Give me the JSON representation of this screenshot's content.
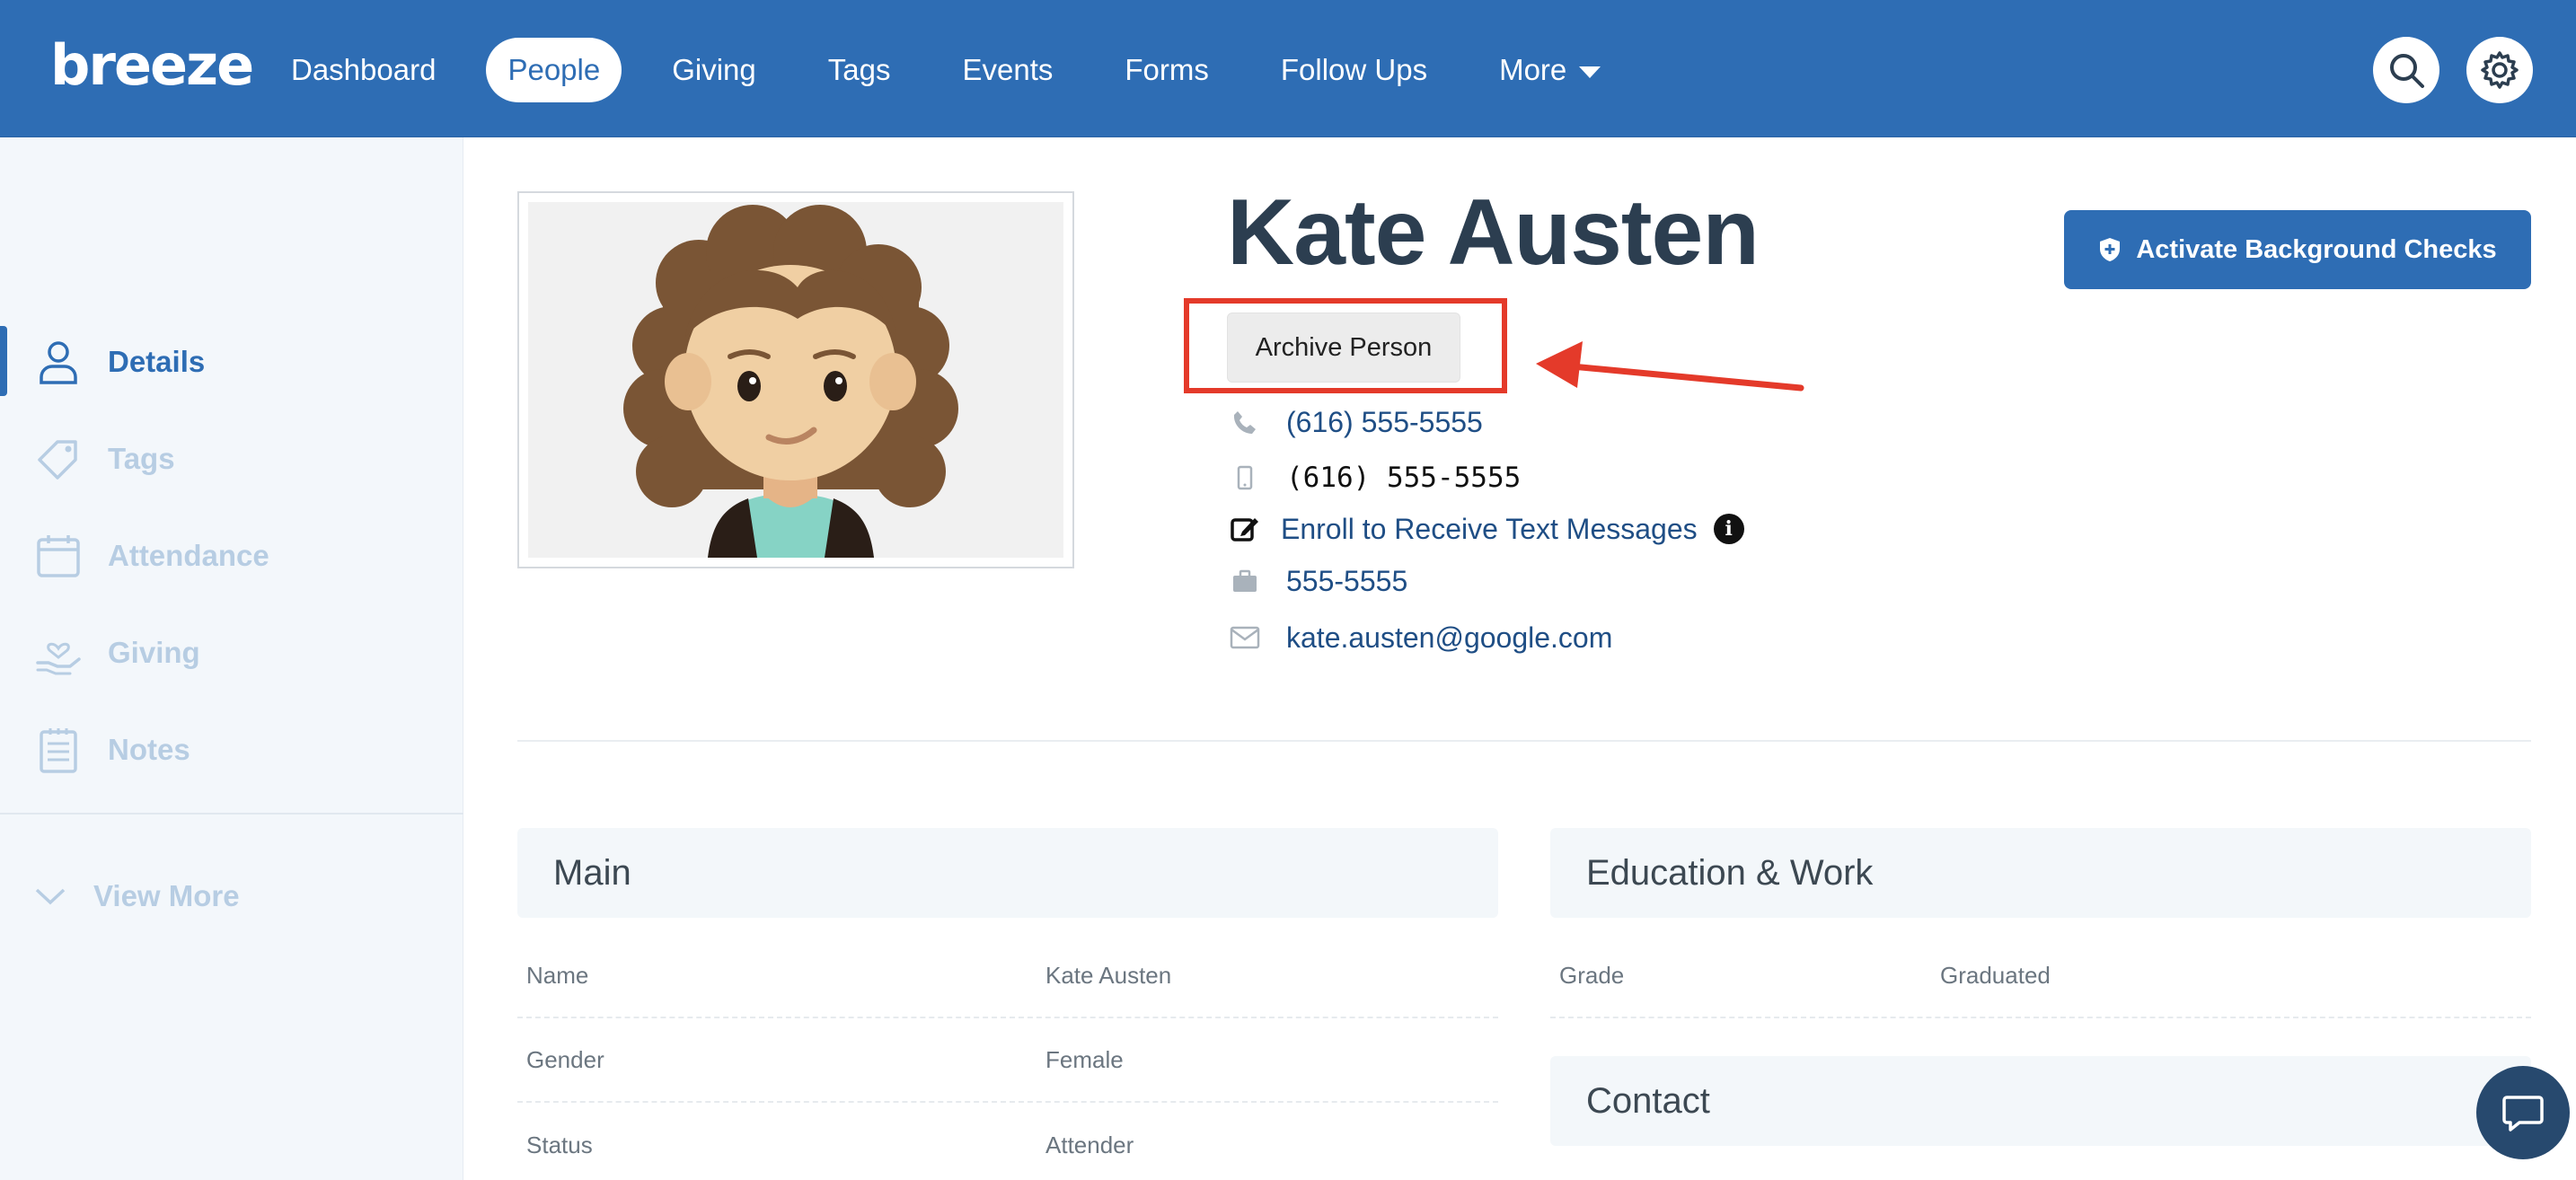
{
  "app": {
    "logo": "breeze"
  },
  "nav": {
    "items": [
      "Dashboard",
      "People",
      "Giving",
      "Tags",
      "Events",
      "Forms",
      "Follow Ups",
      "More"
    ],
    "active": "People"
  },
  "sidebar": {
    "items": [
      {
        "label": "Details",
        "icon": "person-icon"
      },
      {
        "label": "Tags",
        "icon": "tag-icon"
      },
      {
        "label": "Attendance",
        "icon": "calendar-icon"
      },
      {
        "label": "Giving",
        "icon": "hand-heart-icon"
      },
      {
        "label": "Notes",
        "icon": "notes-icon"
      }
    ],
    "view_more": "View More"
  },
  "profile": {
    "name": "Kate Austen",
    "archive_button": "Archive Person",
    "phone_home": "(616) 555-5555",
    "phone_mobile": "(616) 555-5555",
    "enroll_text": "Enroll to Receive Text Messages",
    "phone_work": "555-5555",
    "email": "kate.austen@google.com",
    "background_button": "Activate Background Checks"
  },
  "sections": {
    "main": {
      "title": "Main",
      "rows": [
        {
          "label": "Name",
          "value": "Kate Austen"
        },
        {
          "label": "Gender",
          "value": "Female"
        },
        {
          "label": "Status",
          "value": "Attender"
        }
      ]
    },
    "education": {
      "title": "Education & Work",
      "rows": [
        {
          "label": "Grade",
          "value": "Graduated"
        }
      ]
    },
    "contact": {
      "title": "Contact"
    }
  },
  "colors": {
    "brand": "#2e6db4",
    "highlight": "#e43a2a",
    "link": "#1f4e85"
  }
}
